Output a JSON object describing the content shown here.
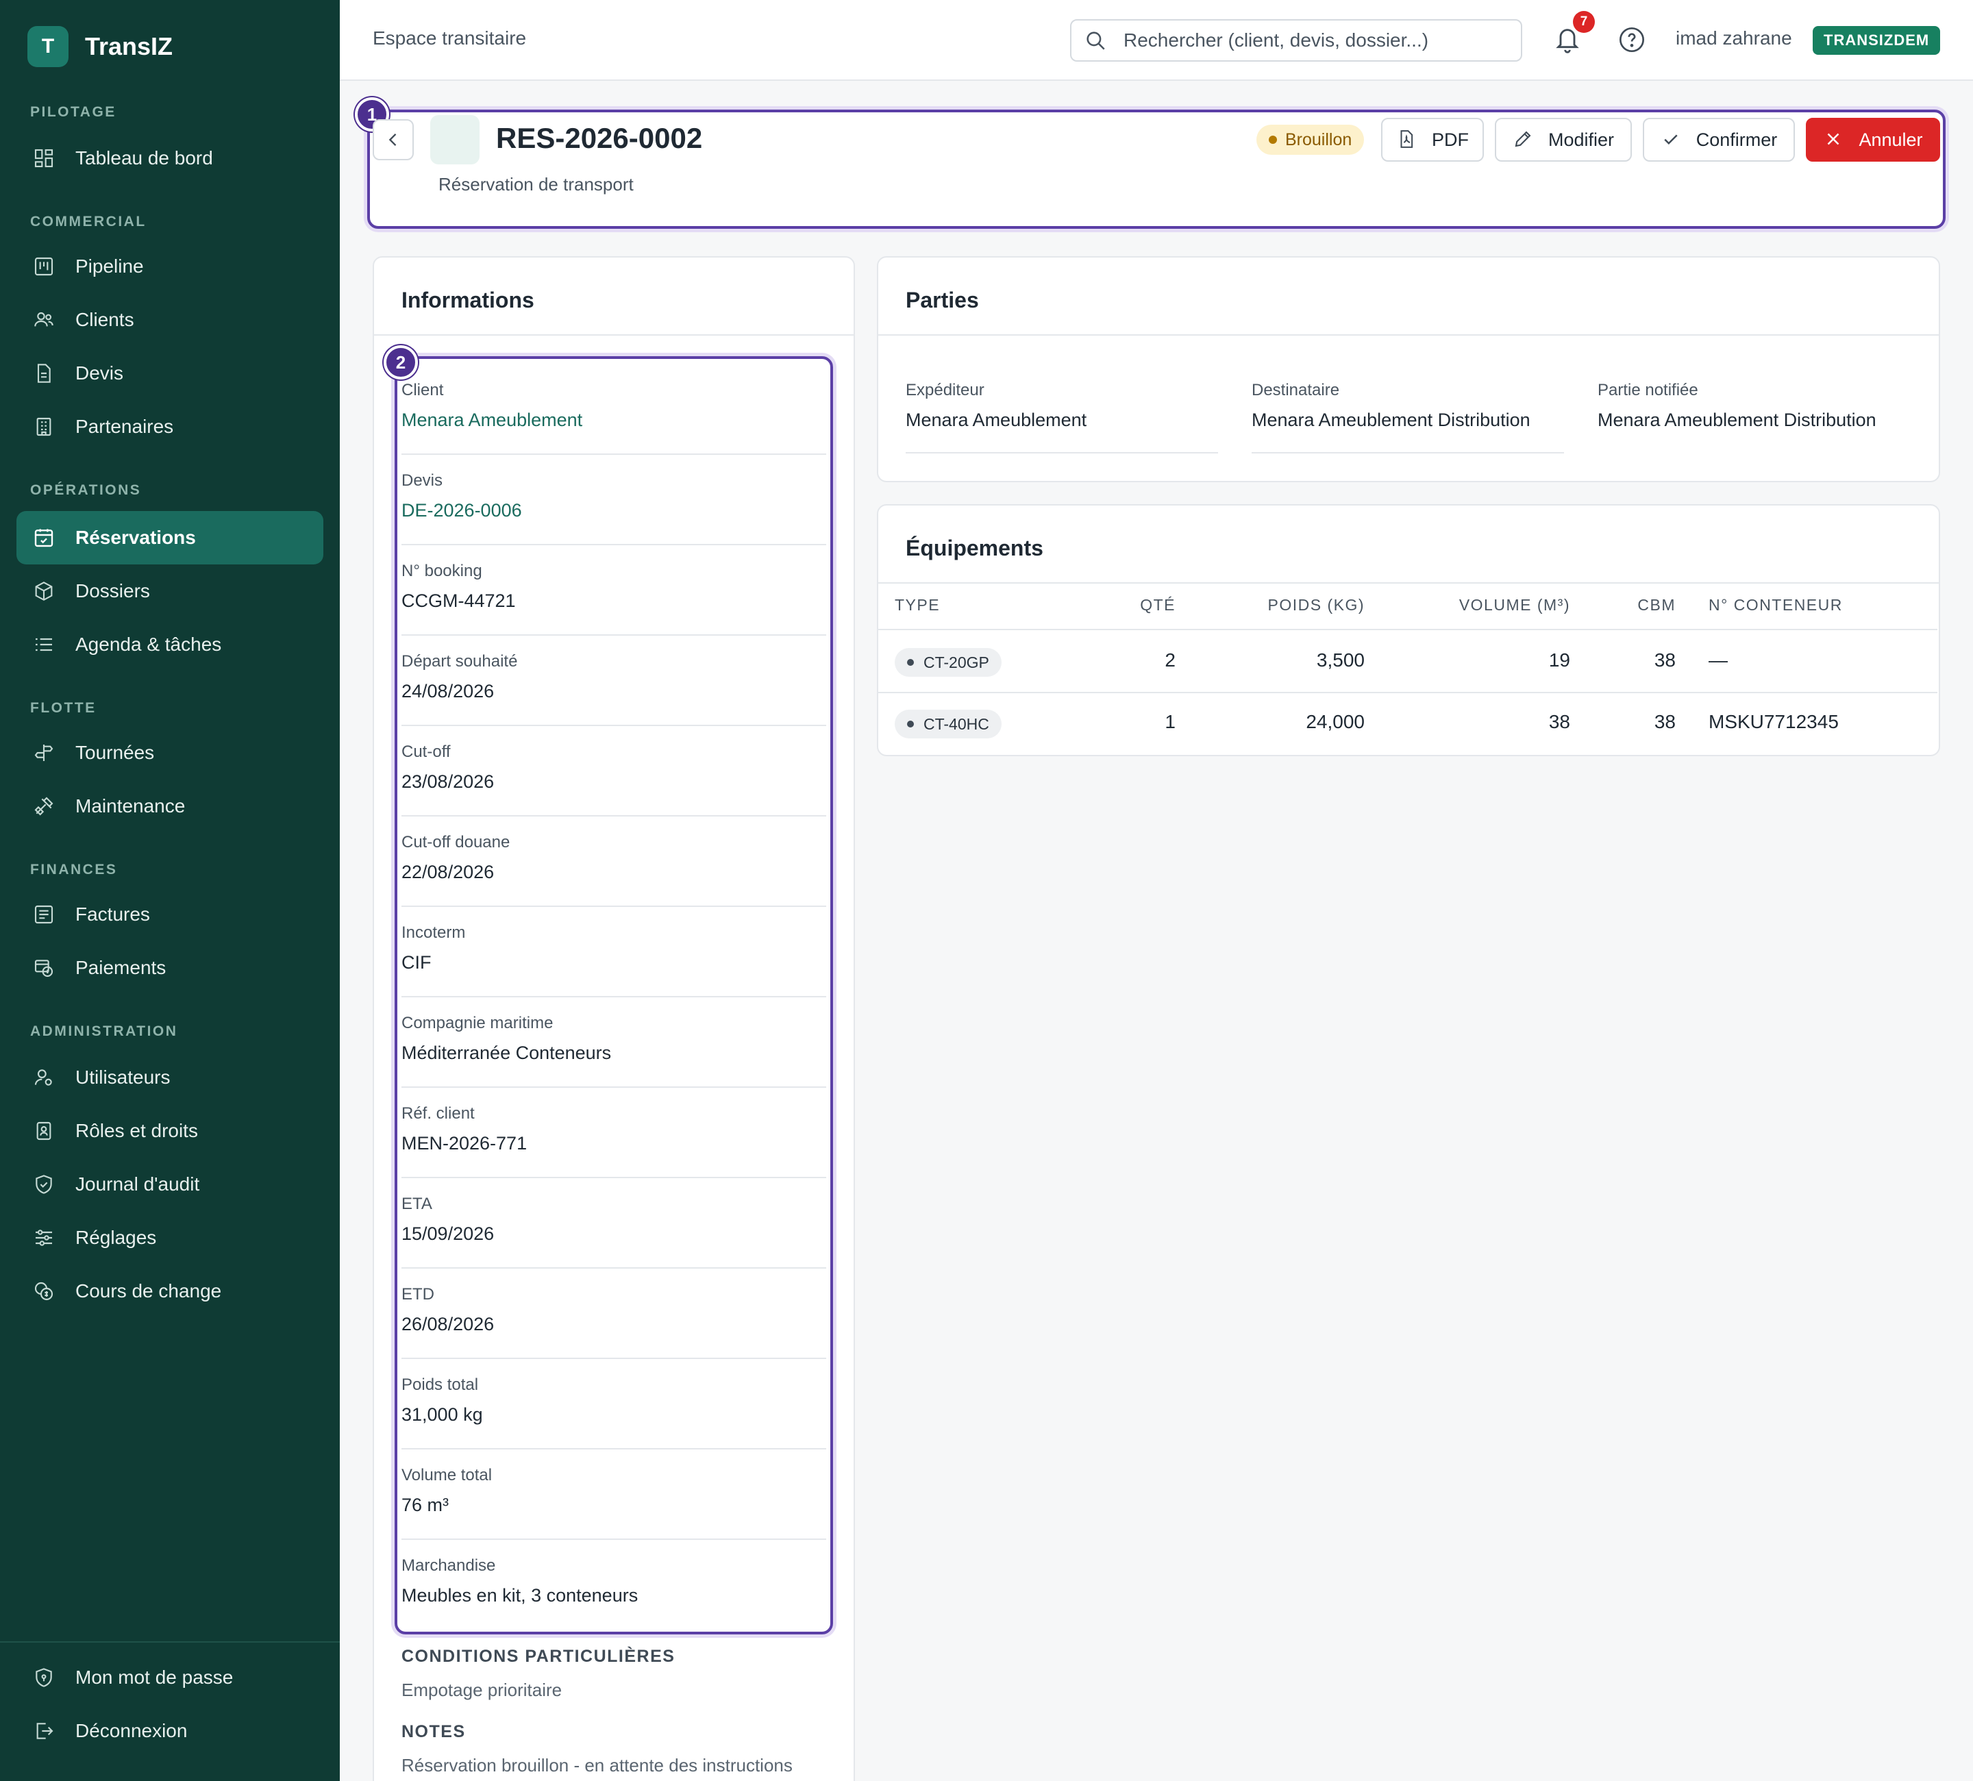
{
  "app": {
    "logo_letter": "T",
    "name": "TransIZ"
  },
  "nav": {
    "sections": {
      "pilotage": "PILOTAGE",
      "commercial": "COMMERCIAL",
      "operations": "OPÉRATIONS",
      "flotte": "FLOTTE",
      "finances": "FINANCES",
      "administration": "ADMINISTRATION"
    },
    "items": {
      "dashboard": "Tableau de bord",
      "pipeline": "Pipeline",
      "clients": "Clients",
      "devis": "Devis",
      "partenaires": "Partenaires",
      "reservations": "Réservations",
      "dossiers": "Dossiers",
      "agenda": "Agenda & tâches",
      "tournees": "Tournées",
      "maintenance": "Maintenance",
      "factures": "Factures",
      "paiements": "Paiements",
      "utilisateurs": "Utilisateurs",
      "roles": "Rôles et droits",
      "audit": "Journal d'audit",
      "reglages": "Réglages",
      "change": "Cours de change",
      "password": "Mon mot de passe",
      "logout": "Déconnexion"
    }
  },
  "topbar": {
    "title": "Espace transitaire",
    "search_placeholder": "Rechercher (client, devis, dossier...)",
    "notifications_count": "7",
    "user_name": "imad zahrane",
    "tenant": "TRANSIZDEM"
  },
  "header": {
    "step": "1",
    "title": "RES-2026-0002",
    "subtitle": "Réservation de transport",
    "status": "Brouillon",
    "buttons": {
      "pdf": "PDF",
      "edit": "Modifier",
      "confirm": "Confirmer",
      "cancel": "Annuler"
    }
  },
  "informations": {
    "title": "Informations",
    "step": "2",
    "fields": [
      {
        "label": "Client",
        "value": "Menara Ameublement"
      },
      {
        "label": "Devis",
        "value": "DE-2026-0006"
      },
      {
        "label": "N° booking",
        "value": "CCGM-44721"
      },
      {
        "label": "Départ souhaité",
        "value": "24/08/2026"
      },
      {
        "label": "Cut-off",
        "value": "23/08/2026"
      },
      {
        "label": "Cut-off douane",
        "value": "22/08/2026"
      },
      {
        "label": "Incoterm",
        "value": "CIF"
      },
      {
        "label": "Compagnie maritime",
        "value": "Méditerranée Conteneurs"
      },
      {
        "label": "Réf. client",
        "value": "MEN-2026-771"
      },
      {
        "label": "ETA",
        "value": "15/09/2026"
      },
      {
        "label": "ETD",
        "value": "26/08/2026"
      },
      {
        "label": "Poids total",
        "value": "31,000 kg"
      },
      {
        "label": "Volume total",
        "value": "76 m³"
      },
      {
        "label": "Marchandise",
        "value": "Meubles en kit, 3 conteneurs"
      }
    ],
    "conditions_title": "CONDITIONS PARTICULIÈRES",
    "conditions_text": "Empotage prioritaire",
    "notes_title": "NOTES",
    "notes_text": "Réservation brouillon - en attente des instructions"
  },
  "parties": {
    "title": "Parties",
    "items": [
      {
        "label": "Expéditeur",
        "value": "Menara Ameublement"
      },
      {
        "label": "Destinataire",
        "value": "Menara Ameublement Distribution"
      },
      {
        "label": "Partie notifiée",
        "value": "Menara Ameublement Distribution"
      }
    ]
  },
  "equipements": {
    "title": "Équipements",
    "columns": {
      "type": "TYPE",
      "qty": "QTÉ",
      "weight": "POIDS (KG)",
      "volume": "VOLUME (M³)",
      "cbm": "CBM",
      "container": "N° CONTENEUR"
    },
    "rows": [
      {
        "type": "CT-20GP",
        "qty": "2",
        "weight": "3,500",
        "volume": "19",
        "cbm": "38",
        "container": "—"
      },
      {
        "type": "CT-40HC",
        "qty": "1",
        "weight": "24,000",
        "volume": "38",
        "cbm": "38",
        "container": "MSKU7712345"
      }
    ]
  }
}
